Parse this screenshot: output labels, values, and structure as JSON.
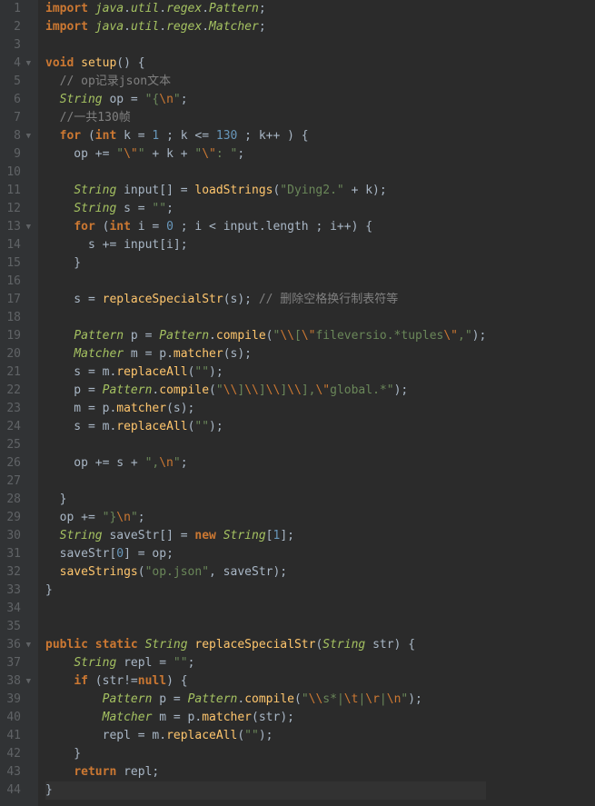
{
  "lines": [
    {
      "n": 1,
      "fold": "",
      "tokens": [
        [
          "kw",
          "import"
        ],
        [
          "op",
          " "
        ],
        [
          "type",
          "java"
        ],
        [
          "op",
          "."
        ],
        [
          "type",
          "util"
        ],
        [
          "op",
          "."
        ],
        [
          "type",
          "regex"
        ],
        [
          "op",
          "."
        ],
        [
          "type",
          "Pattern"
        ],
        [
          "op",
          ";"
        ]
      ]
    },
    {
      "n": 2,
      "fold": "",
      "tokens": [
        [
          "kw",
          "import"
        ],
        [
          "op",
          " "
        ],
        [
          "type",
          "java"
        ],
        [
          "op",
          "."
        ],
        [
          "type",
          "util"
        ],
        [
          "op",
          "."
        ],
        [
          "type",
          "regex"
        ],
        [
          "op",
          "."
        ],
        [
          "type",
          "Matcher"
        ],
        [
          "op",
          ";"
        ]
      ]
    },
    {
      "n": 3,
      "fold": "",
      "tokens": []
    },
    {
      "n": 4,
      "fold": "▼",
      "tokens": [
        [
          "kw",
          "void"
        ],
        [
          "op",
          " "
        ],
        [
          "fn",
          "setup"
        ],
        [
          "op",
          "() {"
        ]
      ]
    },
    {
      "n": 5,
      "fold": "",
      "tokens": [
        [
          "op",
          "  "
        ],
        [
          "cmt",
          "// op记录json文本"
        ]
      ]
    },
    {
      "n": 6,
      "fold": "",
      "tokens": [
        [
          "op",
          "  "
        ],
        [
          "type",
          "String"
        ],
        [
          "op",
          " op = "
        ],
        [
          "str",
          "\"{"
        ],
        [
          "esc",
          "\\n"
        ],
        [
          "str",
          "\""
        ],
        [
          "op",
          ";"
        ]
      ]
    },
    {
      "n": 7,
      "fold": "",
      "tokens": [
        [
          "op",
          "  "
        ],
        [
          "cmt",
          "//一共130帧"
        ]
      ]
    },
    {
      "n": 8,
      "fold": "▼",
      "tokens": [
        [
          "op",
          "  "
        ],
        [
          "kw",
          "for"
        ],
        [
          "op",
          " ("
        ],
        [
          "kw",
          "int"
        ],
        [
          "op",
          " k = "
        ],
        [
          "num",
          "1"
        ],
        [
          "op",
          " ; k <= "
        ],
        [
          "num",
          "130"
        ],
        [
          "op",
          " ; k++ ) {"
        ]
      ]
    },
    {
      "n": 9,
      "fold": "",
      "tokens": [
        [
          "op",
          "    op += "
        ],
        [
          "str",
          "\""
        ],
        [
          "esc",
          "\\\""
        ],
        [
          "str",
          "\""
        ],
        [
          "op",
          " + k + "
        ],
        [
          "str",
          "\""
        ],
        [
          "esc",
          "\\\""
        ],
        [
          "str",
          ": \""
        ],
        [
          "op",
          ";"
        ]
      ]
    },
    {
      "n": 10,
      "fold": "",
      "tokens": []
    },
    {
      "n": 11,
      "fold": "",
      "tokens": [
        [
          "op",
          "    "
        ],
        [
          "type",
          "String"
        ],
        [
          "op",
          " input[] = "
        ],
        [
          "fn",
          "loadStrings"
        ],
        [
          "op",
          "("
        ],
        [
          "str",
          "\"Dying2.\""
        ],
        [
          "op",
          " + k);"
        ]
      ]
    },
    {
      "n": 12,
      "fold": "",
      "tokens": [
        [
          "op",
          "    "
        ],
        [
          "type",
          "String"
        ],
        [
          "op",
          " s = "
        ],
        [
          "str",
          "\"\""
        ],
        [
          "op",
          ";"
        ]
      ]
    },
    {
      "n": 13,
      "fold": "▼",
      "tokens": [
        [
          "op",
          "    "
        ],
        [
          "kw",
          "for"
        ],
        [
          "op",
          " ("
        ],
        [
          "kw",
          "int"
        ],
        [
          "op",
          " i = "
        ],
        [
          "num",
          "0"
        ],
        [
          "op",
          " ; i < input."
        ],
        [
          "id",
          "length"
        ],
        [
          "op",
          " ; i++) {"
        ]
      ]
    },
    {
      "n": 14,
      "fold": "",
      "tokens": [
        [
          "op",
          "      s += input[i];"
        ]
      ]
    },
    {
      "n": 15,
      "fold": "",
      "tokens": [
        [
          "op",
          "    }"
        ]
      ]
    },
    {
      "n": 16,
      "fold": "",
      "tokens": []
    },
    {
      "n": 17,
      "fold": "",
      "tokens": [
        [
          "op",
          "    s = "
        ],
        [
          "fn",
          "replaceSpecialStr"
        ],
        [
          "op",
          "(s); "
        ],
        [
          "cmt",
          "// 删除空格换行制表符等"
        ]
      ]
    },
    {
      "n": 18,
      "fold": "",
      "tokens": []
    },
    {
      "n": 19,
      "fold": "",
      "tokens": [
        [
          "op",
          "    "
        ],
        [
          "type",
          "Pattern"
        ],
        [
          "op",
          " p = "
        ],
        [
          "type",
          "Pattern"
        ],
        [
          "op",
          "."
        ],
        [
          "fn",
          "compile"
        ],
        [
          "op",
          "("
        ],
        [
          "str",
          "\""
        ],
        [
          "esc",
          "\\\\"
        ],
        [
          "str",
          "["
        ],
        [
          "esc",
          "\\\""
        ],
        [
          "str",
          "fileversio.*tuples"
        ],
        [
          "esc",
          "\\\""
        ],
        [
          "str",
          ",\""
        ],
        [
          "op",
          ");"
        ]
      ]
    },
    {
      "n": 20,
      "fold": "",
      "tokens": [
        [
          "op",
          "    "
        ],
        [
          "type",
          "Matcher"
        ],
        [
          "op",
          " m = p."
        ],
        [
          "fn",
          "matcher"
        ],
        [
          "op",
          "(s);"
        ]
      ]
    },
    {
      "n": 21,
      "fold": "",
      "tokens": [
        [
          "op",
          "    s = m."
        ],
        [
          "fn",
          "replaceAll"
        ],
        [
          "op",
          "("
        ],
        [
          "str",
          "\"\""
        ],
        [
          "op",
          ");"
        ]
      ]
    },
    {
      "n": 22,
      "fold": "",
      "tokens": [
        [
          "op",
          "    p = "
        ],
        [
          "type",
          "Pattern"
        ],
        [
          "op",
          "."
        ],
        [
          "fn",
          "compile"
        ],
        [
          "op",
          "("
        ],
        [
          "str",
          "\""
        ],
        [
          "esc",
          "\\\\"
        ],
        [
          "str",
          "]"
        ],
        [
          "esc",
          "\\\\"
        ],
        [
          "str",
          "]"
        ],
        [
          "esc",
          "\\\\"
        ],
        [
          "str",
          "]"
        ],
        [
          "esc",
          "\\\\"
        ],
        [
          "str",
          "],"
        ],
        [
          "esc",
          "\\\""
        ],
        [
          "str",
          "global.*\""
        ],
        [
          "op",
          ");"
        ]
      ]
    },
    {
      "n": 23,
      "fold": "",
      "tokens": [
        [
          "op",
          "    m = p."
        ],
        [
          "fn",
          "matcher"
        ],
        [
          "op",
          "(s);"
        ]
      ]
    },
    {
      "n": 24,
      "fold": "",
      "tokens": [
        [
          "op",
          "    s = m."
        ],
        [
          "fn",
          "replaceAll"
        ],
        [
          "op",
          "("
        ],
        [
          "str",
          "\"\""
        ],
        [
          "op",
          ");"
        ]
      ]
    },
    {
      "n": 25,
      "fold": "",
      "tokens": []
    },
    {
      "n": 26,
      "fold": "",
      "tokens": [
        [
          "op",
          "    op += s + "
        ],
        [
          "str",
          "\","
        ],
        [
          "esc",
          "\\n"
        ],
        [
          "str",
          "\""
        ],
        [
          "op",
          ";"
        ]
      ]
    },
    {
      "n": 27,
      "fold": "",
      "tokens": []
    },
    {
      "n": 28,
      "fold": "",
      "tokens": [
        [
          "op",
          "  }"
        ]
      ]
    },
    {
      "n": 29,
      "fold": "",
      "tokens": [
        [
          "op",
          "  op += "
        ],
        [
          "str",
          "\"}"
        ],
        [
          "esc",
          "\\n"
        ],
        [
          "str",
          "\""
        ],
        [
          "op",
          ";"
        ]
      ]
    },
    {
      "n": 30,
      "fold": "",
      "tokens": [
        [
          "op",
          "  "
        ],
        [
          "type",
          "String"
        ],
        [
          "op",
          " saveStr[] = "
        ],
        [
          "kw",
          "new"
        ],
        [
          "op",
          " "
        ],
        [
          "type",
          "String"
        ],
        [
          "op",
          "["
        ],
        [
          "num",
          "1"
        ],
        [
          "op",
          "];"
        ]
      ]
    },
    {
      "n": 31,
      "fold": "",
      "tokens": [
        [
          "op",
          "  saveStr["
        ],
        [
          "num",
          "0"
        ],
        [
          "op",
          "] = op;"
        ]
      ]
    },
    {
      "n": 32,
      "fold": "",
      "tokens": [
        [
          "op",
          "  "
        ],
        [
          "fn",
          "saveStrings"
        ],
        [
          "op",
          "("
        ],
        [
          "str",
          "\"op.json\""
        ],
        [
          "op",
          ", saveStr);"
        ]
      ]
    },
    {
      "n": 33,
      "fold": "",
      "tokens": [
        [
          "op",
          "}"
        ]
      ]
    },
    {
      "n": 34,
      "fold": "",
      "tokens": []
    },
    {
      "n": 35,
      "fold": "",
      "tokens": []
    },
    {
      "n": 36,
      "fold": "▼",
      "tokens": [
        [
          "kw",
          "public"
        ],
        [
          "op",
          " "
        ],
        [
          "kw",
          "static"
        ],
        [
          "op",
          " "
        ],
        [
          "type",
          "String"
        ],
        [
          "op",
          " "
        ],
        [
          "fn",
          "replaceSpecialStr"
        ],
        [
          "op",
          "("
        ],
        [
          "type",
          "String"
        ],
        [
          "op",
          " str) {"
        ]
      ]
    },
    {
      "n": 37,
      "fold": "",
      "tokens": [
        [
          "op",
          "    "
        ],
        [
          "type",
          "String"
        ],
        [
          "op",
          " repl = "
        ],
        [
          "str",
          "\"\""
        ],
        [
          "op",
          ";"
        ]
      ]
    },
    {
      "n": 38,
      "fold": "▼",
      "tokens": [
        [
          "op",
          "    "
        ],
        [
          "kw",
          "if"
        ],
        [
          "op",
          " (str!="
        ],
        [
          "kw",
          "null"
        ],
        [
          "op",
          ") {"
        ]
      ]
    },
    {
      "n": 39,
      "fold": "",
      "tokens": [
        [
          "op",
          "        "
        ],
        [
          "type",
          "Pattern"
        ],
        [
          "op",
          " p = "
        ],
        [
          "type",
          "Pattern"
        ],
        [
          "op",
          "."
        ],
        [
          "fn",
          "compile"
        ],
        [
          "op",
          "("
        ],
        [
          "str",
          "\""
        ],
        [
          "esc",
          "\\\\"
        ],
        [
          "str",
          "s*|"
        ],
        [
          "esc",
          "\\t"
        ],
        [
          "str",
          "|"
        ],
        [
          "esc",
          "\\r"
        ],
        [
          "str",
          "|"
        ],
        [
          "esc",
          "\\n"
        ],
        [
          "str",
          "\""
        ],
        [
          "op",
          ");"
        ]
      ]
    },
    {
      "n": 40,
      "fold": "",
      "tokens": [
        [
          "op",
          "        "
        ],
        [
          "type",
          "Matcher"
        ],
        [
          "op",
          " m = p."
        ],
        [
          "fn",
          "matcher"
        ],
        [
          "op",
          "(str);"
        ]
      ]
    },
    {
      "n": 41,
      "fold": "",
      "tokens": [
        [
          "op",
          "        repl = m."
        ],
        [
          "fn",
          "replaceAll"
        ],
        [
          "op",
          "("
        ],
        [
          "str",
          "\"\""
        ],
        [
          "op",
          ");"
        ]
      ]
    },
    {
      "n": 42,
      "fold": "",
      "tokens": [
        [
          "op",
          "    }"
        ]
      ]
    },
    {
      "n": 43,
      "fold": "",
      "tokens": [
        [
          "op",
          "    "
        ],
        [
          "kw",
          "return"
        ],
        [
          "op",
          " repl;"
        ]
      ]
    },
    {
      "n": 44,
      "fold": "",
      "cur": true,
      "tokens": [
        [
          "op",
          "}"
        ]
      ]
    }
  ]
}
